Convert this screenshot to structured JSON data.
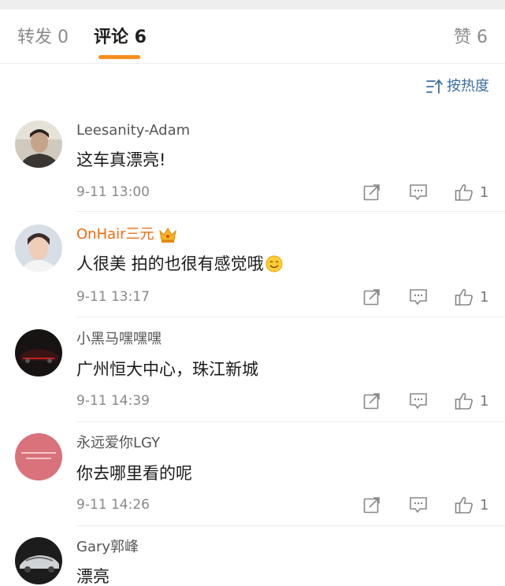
{
  "tabs": {
    "repost": "转发 0",
    "comment": "评论 6",
    "likes": "赞 6"
  },
  "sort": {
    "label": "按热度",
    "icon": "sort-icon"
  },
  "comments": [
    {
      "user": "Leesanity-Adam",
      "text": "这车真漂亮!",
      "time": "9-11 13:00",
      "likes": "1"
    },
    {
      "user": "OnHair三元",
      "text": "人很美 拍的也很有感觉哦",
      "time": "9-11 13:17",
      "likes": "1",
      "badge": "crown-icon",
      "emoji": "smile-emoji-icon"
    },
    {
      "user": "小黑马嘿嘿嘿",
      "text": "广州恒大中心，珠江新城",
      "time": "9-11 14:39",
      "likes": "1"
    },
    {
      "user": "永远爱你LGY",
      "text": "你去哪里看的呢",
      "time": "9-11 14:26",
      "likes": "1"
    },
    {
      "user": "Gary郭峰",
      "text": "漂亮"
    }
  ],
  "colors": {
    "accent": "#f78e1e",
    "link": "#3b6ea5",
    "vip_name": "#f06a0f"
  }
}
